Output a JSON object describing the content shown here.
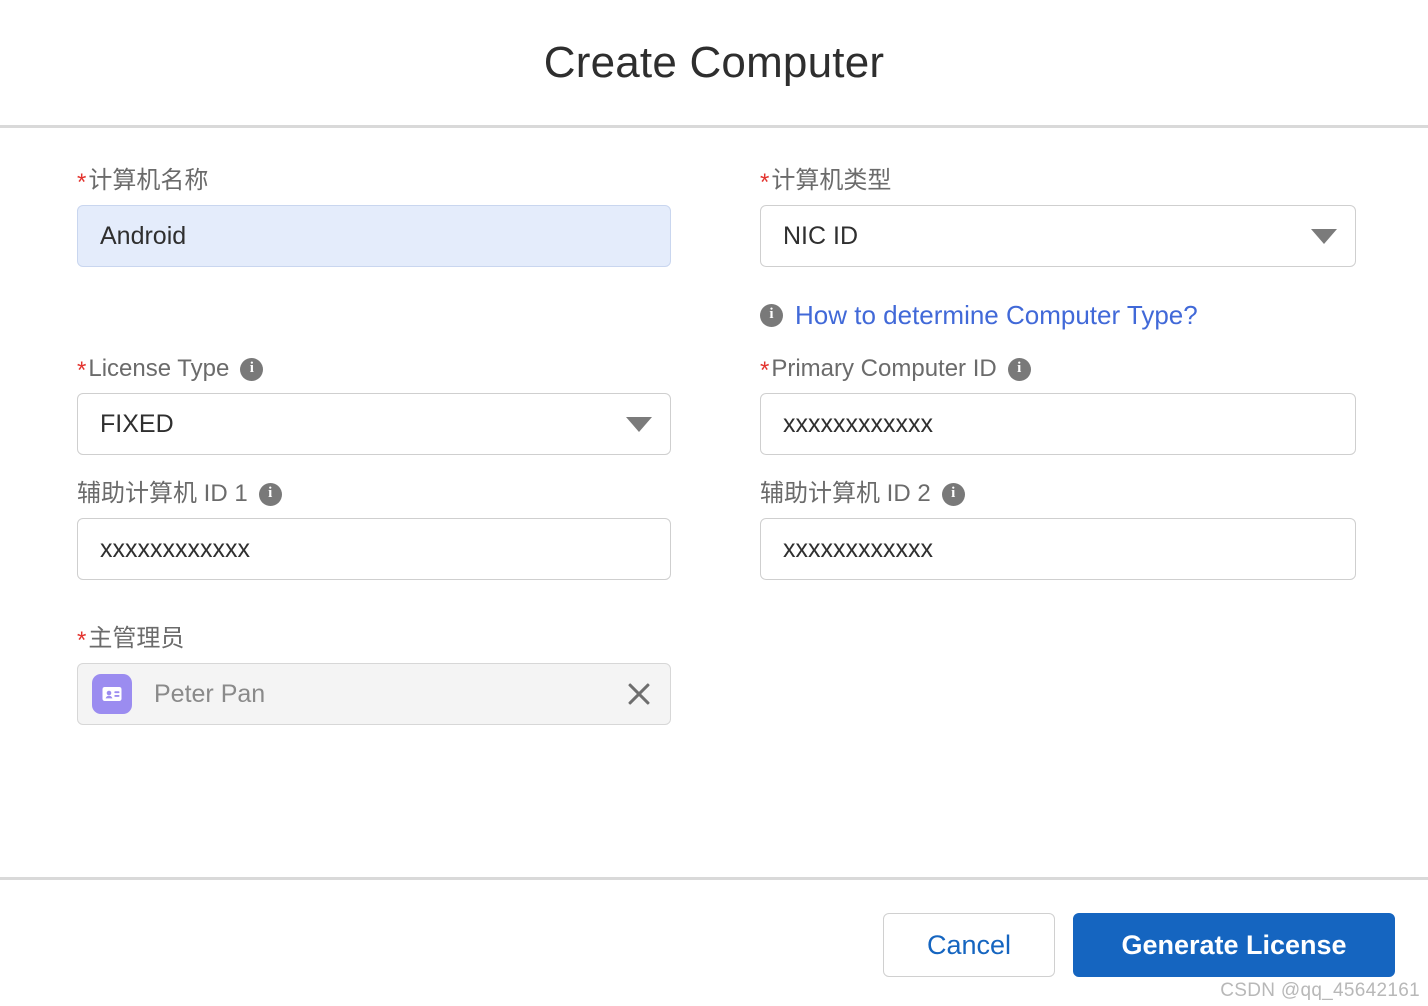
{
  "header": {
    "title": "Create Computer"
  },
  "form": {
    "left": {
      "computer_name": {
        "label": "计算机名称",
        "required": true,
        "value": "Android"
      },
      "license_type": {
        "label": "License Type",
        "required": true,
        "has_info": true,
        "value": "FIXED",
        "options": [
          "FIXED"
        ]
      },
      "aux_computer_id_1": {
        "label": "辅助计算机 ID 1",
        "required": false,
        "has_info": true,
        "value": "xxxxxxxxxxxx"
      },
      "primary_admin": {
        "label": "主管理员",
        "required": true,
        "value": "Peter Pan",
        "avatar_icon": "contact-card-icon",
        "avatar_color": "#9b8cf0",
        "clear_icon": "close-icon"
      }
    },
    "right": {
      "computer_type": {
        "label": "计算机类型",
        "required": true,
        "value": "NIC ID",
        "options": [
          "NIC ID"
        ]
      },
      "help_link": {
        "icon": "info-icon",
        "text": "How to determine Computer Type?",
        "color": "#4169d8"
      },
      "primary_computer_id": {
        "label": "Primary Computer ID",
        "required": true,
        "has_info": true,
        "value": "xxxxxxxxxxxx"
      },
      "aux_computer_id_2": {
        "label": "辅助计算机 ID 2",
        "required": false,
        "has_info": true,
        "value": "xxxxxxxxxxxx"
      }
    }
  },
  "footer": {
    "cancel_label": "Cancel",
    "submit_label": "Generate License"
  },
  "watermark": "CSDN @qq_45642161",
  "icons": {
    "info": "i",
    "required_star": "*"
  },
  "colors": {
    "accent": "#1565c0",
    "link": "#4169d8",
    "required": "#e3342f",
    "focused_input_bg": "#e4ecfb",
    "avatar": "#9b8cf0"
  }
}
